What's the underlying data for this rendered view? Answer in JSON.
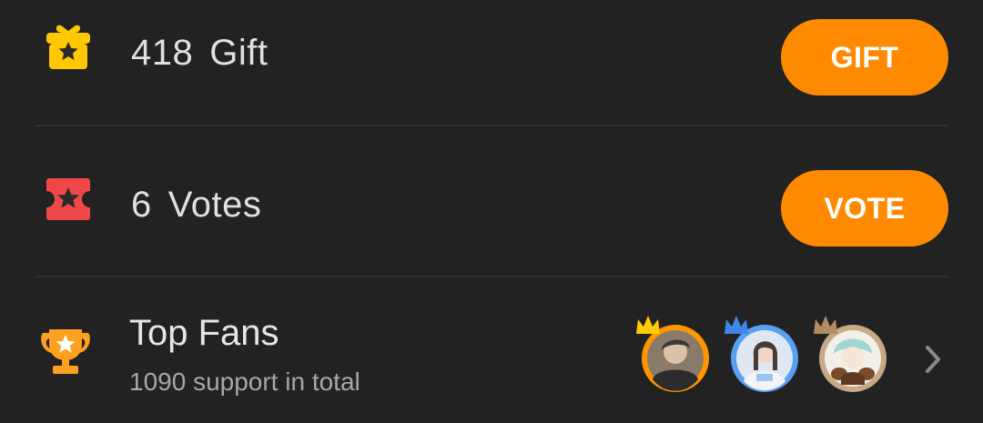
{
  "gift": {
    "count": "418",
    "label": "Gift",
    "button": "GIFT"
  },
  "votes": {
    "count": "6",
    "label": "Votes",
    "button": "VOTE"
  },
  "fans": {
    "title": "Top Fans",
    "subtitle": "1090 support in total",
    "avatars": [
      {
        "rank": 1,
        "ring": "#ff9500",
        "crown": "#ffcc00"
      },
      {
        "rank": 2,
        "ring": "#5aa0f0",
        "crown": "#3d86e8"
      },
      {
        "rank": 3,
        "ring": "#c9a884",
        "crown": "#b38c62"
      }
    ]
  },
  "icons": {
    "gift": "gift-icon",
    "votes": "ticket-icon",
    "fans": "trophy-icon",
    "more": "chevron-right-icon"
  },
  "colors": {
    "background": "#222222",
    "accent": "#ff8a00",
    "gift_icon": "#ffc800",
    "ticket_icon": "#f04848",
    "trophy_icon": "#ffa020"
  }
}
